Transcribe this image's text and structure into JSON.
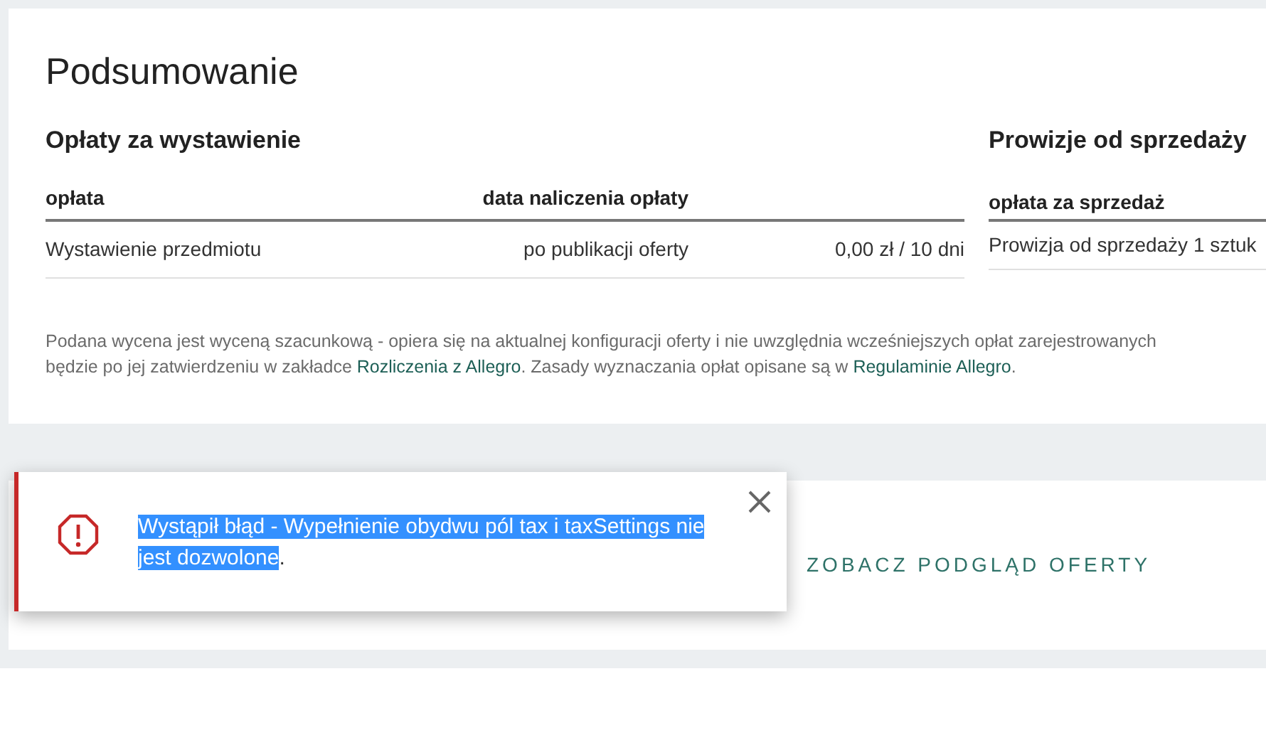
{
  "summary": {
    "title": "Podsumowanie",
    "listing_fees": {
      "heading": "Opłaty za wystawienie",
      "columns": [
        "opłata",
        "data naliczenia opłaty"
      ],
      "rows": [
        {
          "cells": [
            "Wystawienie przedmiotu",
            "po publikacji oferty",
            "0,00 zł / 10 dni"
          ]
        }
      ]
    },
    "commissions": {
      "heading": "Prowizje od sprzedaży",
      "columns": [
        "opłata za sprzedaż"
      ],
      "rows": [
        {
          "cells": [
            "Prowizja od sprzedaży 1 sztuk"
          ]
        }
      ]
    },
    "note": {
      "lines": [
        [
          {
            "kind": "text",
            "text": "Podana wycena jest wyceną szacunkową - opiera się na aktualnej konfiguracji oferty i nie uwzględnia wcześniejszych opłat zarejestrowanych"
          }
        ],
        [
          {
            "kind": "text",
            "text": "będzie po jej zatwierdzeniu w zakładce "
          },
          {
            "kind": "link",
            "text": "Rozliczenia z Allegro"
          },
          {
            "kind": "text",
            "text": ". Zasady wyznaczania opłat opisane są w "
          },
          {
            "kind": "link",
            "text": "Regulaminie Allegro"
          },
          {
            "kind": "text",
            "text": "."
          }
        ]
      ]
    }
  },
  "actions": {
    "preview_link": "ZOBACZ PODGLĄD OFERTY"
  },
  "error_toast": {
    "message": "Wystąpił błąd - Wypełnienie obydwu pól tax i taxSettings nie jest dozwolone",
    "selected": true,
    "tail": "."
  }
}
